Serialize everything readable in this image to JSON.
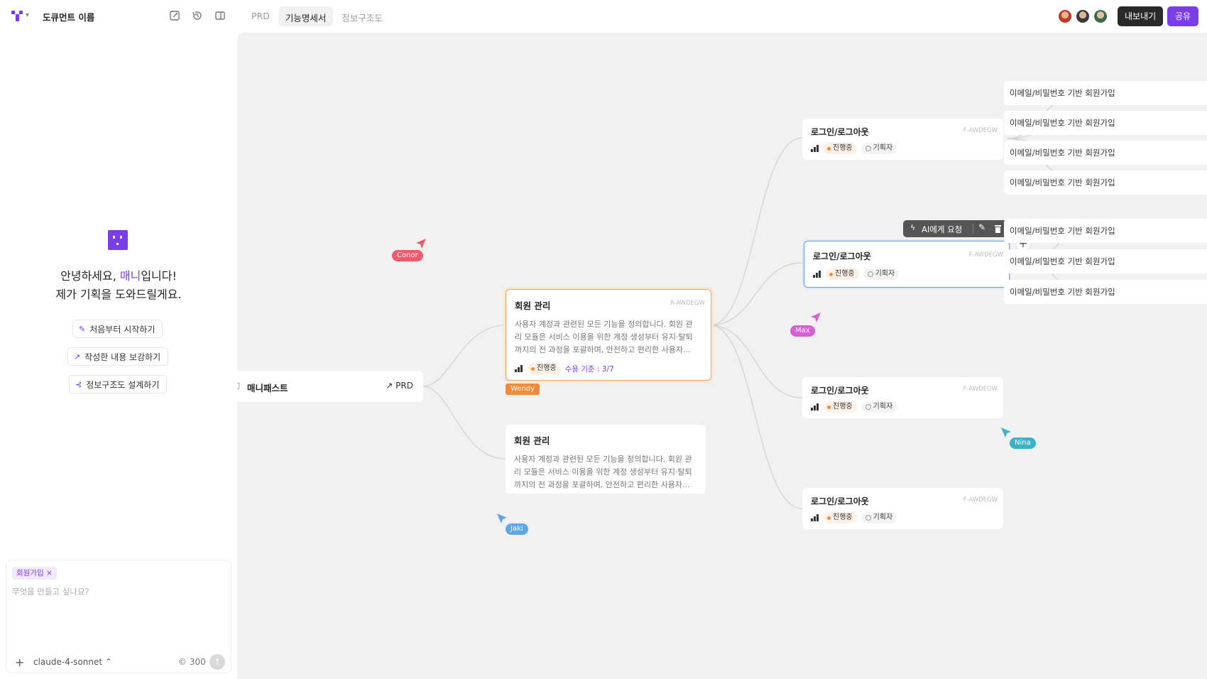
{
  "topbar": {
    "doc_title": "도큐먼트 이름",
    "tabs": [
      {
        "label": "PRD",
        "active": false
      },
      {
        "label": "기능명세서",
        "active": true
      },
      {
        "label": "정보구조도",
        "active": false
      }
    ],
    "export_label": "내보내기",
    "share_label": "공유",
    "accent": "#7a3de8"
  },
  "left": {
    "greet_line1_pre": "안녕하세요, ",
    "greet_name": "매니",
    "greet_line1_post": "입니다!",
    "greet_line2": "제가 기획을 도와드릴게요.",
    "actions": [
      {
        "label": "처음부터 시작하기",
        "icon": "edit-icon"
      },
      {
        "label": "작성한 내용 보강하기",
        "icon": "arrow-up-right-icon"
      },
      {
        "label": "정보구조도 설계하기",
        "icon": "sitemap-icon"
      }
    ],
    "chat": {
      "chip": "회원가입",
      "chip_close": "×",
      "placeholder": "무엇을 만들고 싶나요?",
      "model": "claude-4-sonnet",
      "credits": "300"
    }
  },
  "canvas": {
    "root": {
      "title": "매니패스트",
      "link": "PRD"
    },
    "mid_cards": [
      {
        "title": "회원 관리",
        "code": "R-AWDEGW",
        "desc": "사용자 계정과 관련된 모든 기능을 정의합니다. 회원 관리 모듈은 서비스 이용을 위한 계정 생성부터 유지·탈퇴까지의 전 과정을 포괄하며, 안전하고 편리한 사용자...",
        "status": "진행중",
        "accept": "수용 기준 : 3/7"
      },
      {
        "title": "회원 관리",
        "desc": "사용자 계정과 관련된 모든 기능을 정의합니다. 회원 관리 모듈은 서비스 이용을 위한 계정 생성부터 유지·탈퇴까지의 전 과정을 포괄하며, 안전하고 편리한 사용자..."
      }
    ],
    "feature_cards": [
      {
        "title": "로그인/로그아웃",
        "code": "F-AWDEGW",
        "status": "진행중",
        "role": "기획자"
      },
      {
        "title": "로그인/로그아웃",
        "code": "F-AWDEGW",
        "status": "진행중",
        "role": "기획자"
      },
      {
        "title": "로그인/로그아웃",
        "code": "F-AWDEGW",
        "status": "진행중",
        "role": "기획자"
      },
      {
        "title": "로그인/로그아웃",
        "code": "F-AWDEGW",
        "status": "진행중",
        "role": "기획자"
      }
    ],
    "leaves": [
      "이메일/비밀번호 기반 회원가입",
      "이메일/비밀번호 기반 회원가입",
      "이메일/비밀번호 기반 회원가입",
      "이메일/비밀번호 기반 회원가입",
      "이메일/비밀번호 기반 회원가입",
      "이메일/비밀번호 기반 회원가입",
      "이메일/비밀번호 기반 회원가입"
    ],
    "toolbar": {
      "ai_label": "AI에게 요청"
    },
    "cursors": [
      {
        "name": "Conor",
        "color": "#ef5b6e"
      },
      {
        "name": "Max",
        "color": "#d85fd6"
      },
      {
        "name": "Wendy",
        "color": "#f08a3c"
      },
      {
        "name": "Nina",
        "color": "#3ab3c9"
      },
      {
        "name": "Jaki",
        "color": "#5aa8e8"
      }
    ]
  }
}
